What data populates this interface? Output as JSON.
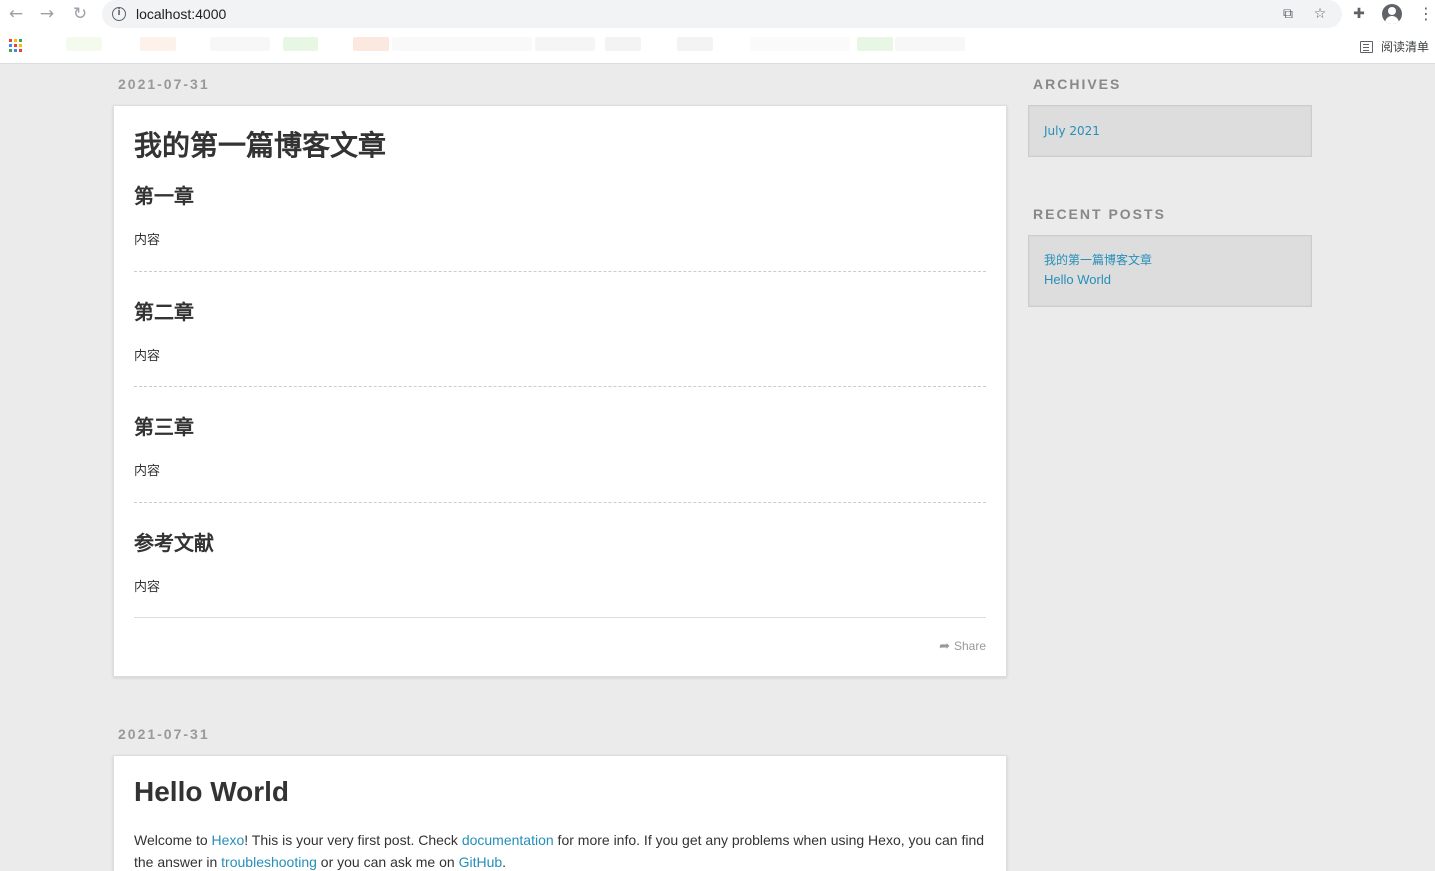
{
  "browser": {
    "url": "localhost:4000",
    "reading_list_label": "阅读清单"
  },
  "posts": [
    {
      "date": "2021-07-31",
      "title": "我的第一篇博客文章",
      "sections": [
        {
          "heading": "第一章",
          "text": "内容"
        },
        {
          "heading": "第二章",
          "text": "内容"
        },
        {
          "heading": "第三章",
          "text": "内容"
        },
        {
          "heading": "参考文献",
          "text": "内容"
        }
      ],
      "share_label": "Share"
    },
    {
      "date": "2021-07-31",
      "title": "Hello World",
      "body": {
        "t1": "Welcome to ",
        "l1": "Hexo",
        "t2": "! This is your very first post. Check ",
        "l2": "documentation",
        "t3": " for more info. If you get any problems when using Hexo, you can find the answer in ",
        "l3": "troubleshooting",
        "t4": " or you can ask me on ",
        "l4": "GitHub",
        "t5": "."
      }
    }
  ],
  "sidebar": {
    "archives_title": "ARCHIVES",
    "archives": [
      "July 2021"
    ],
    "recent_title": "RECENT POSTS",
    "recent": [
      "我的第一篇博客文章",
      "Hello World"
    ]
  },
  "colors": {
    "link": "#258fb8",
    "background": "#ebebeb"
  }
}
